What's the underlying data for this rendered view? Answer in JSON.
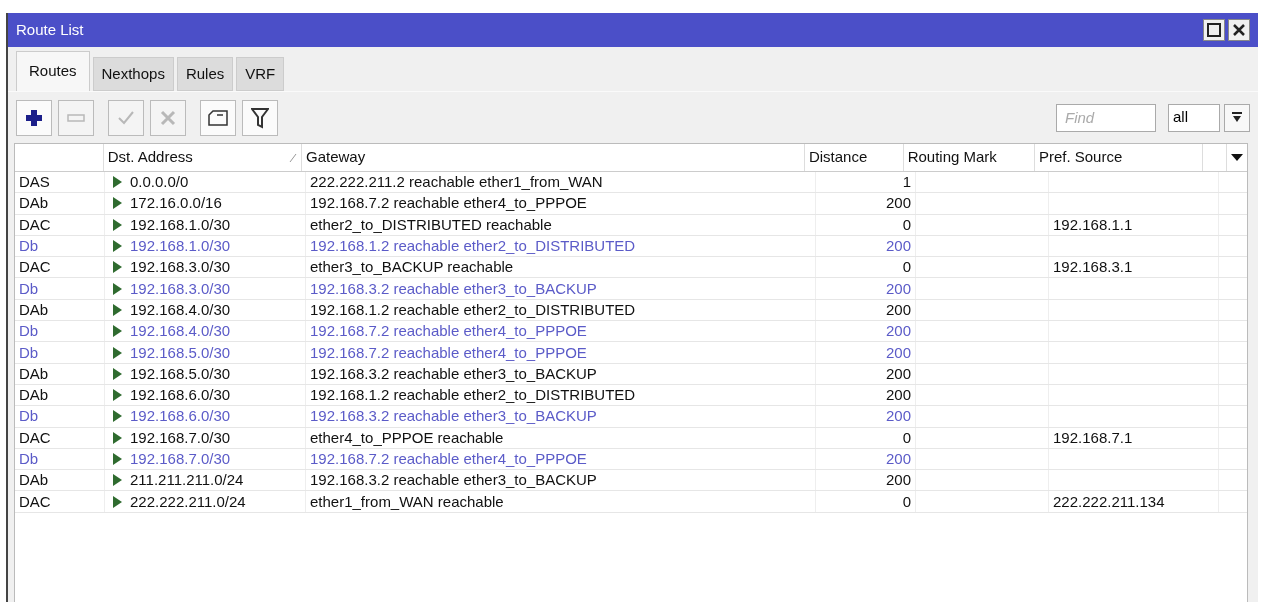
{
  "window": {
    "title": "Route List"
  },
  "tabs": [
    {
      "label": "Routes",
      "selected": true
    },
    {
      "label": "Nexthops",
      "selected": false
    },
    {
      "label": "Rules",
      "selected": false
    },
    {
      "label": "VRF",
      "selected": false
    }
  ],
  "toolbar": {
    "buttons": [
      {
        "kind": "add",
        "disabled": false
      },
      {
        "kind": "remove",
        "disabled": true
      },
      {
        "kind": "enable",
        "disabled": true
      },
      {
        "kind": "disable",
        "disabled": true
      },
      {
        "kind": "comment",
        "disabled": false
      },
      {
        "kind": "filter",
        "disabled": false
      }
    ],
    "find": {
      "placeholder": "Find"
    },
    "scope": {
      "value": "all"
    }
  },
  "table": {
    "columns": [
      {
        "label": "Dst. Address",
        "sorted": true
      },
      {
        "label": "Gateway",
        "sorted": false
      },
      {
        "label": "Distance",
        "sorted": false
      },
      {
        "label": "Routing Mark",
        "sorted": false
      },
      {
        "label": "Pref. Source",
        "sorted": false
      }
    ],
    "rows": [
      {
        "flags": "DAS",
        "active": true,
        "cells": [
          "0.0.0.0/0",
          "222.222.211.2 reachable ether1_from_WAN",
          "1",
          "",
          ""
        ]
      },
      {
        "flags": "DAb",
        "active": true,
        "cells": [
          "172.16.0.0/16",
          "192.168.7.2 reachable ether4_to_PPPOE",
          "200",
          "",
          ""
        ]
      },
      {
        "flags": "DAC",
        "active": true,
        "cells": [
          "192.168.1.0/30",
          "ether2_to_DISTRIBUTED reachable",
          "0",
          "",
          "192.168.1.1"
        ]
      },
      {
        "flags": "Db",
        "active": false,
        "cells": [
          "192.168.1.0/30",
          "192.168.1.2 reachable ether2_to_DISTRIBUTED",
          "200",
          "",
          ""
        ]
      },
      {
        "flags": "DAC",
        "active": true,
        "cells": [
          "192.168.3.0/30",
          "ether3_to_BACKUP reachable",
          "0",
          "",
          "192.168.3.1"
        ]
      },
      {
        "flags": "Db",
        "active": false,
        "cells": [
          "192.168.3.0/30",
          "192.168.3.2 reachable ether3_to_BACKUP",
          "200",
          "",
          ""
        ]
      },
      {
        "flags": "DAb",
        "active": true,
        "cells": [
          "192.168.4.0/30",
          "192.168.1.2 reachable ether2_to_DISTRIBUTED",
          "200",
          "",
          ""
        ]
      },
      {
        "flags": "Db",
        "active": false,
        "cells": [
          "192.168.4.0/30",
          "192.168.7.2 reachable ether4_to_PPPOE",
          "200",
          "",
          ""
        ]
      },
      {
        "flags": "Db",
        "active": false,
        "cells": [
          "192.168.5.0/30",
          "192.168.7.2 reachable ether4_to_PPPOE",
          "200",
          "",
          ""
        ]
      },
      {
        "flags": "DAb",
        "active": true,
        "cells": [
          "192.168.5.0/30",
          "192.168.3.2 reachable ether3_to_BACKUP",
          "200",
          "",
          ""
        ]
      },
      {
        "flags": "DAb",
        "active": true,
        "cells": [
          "192.168.6.0/30",
          "192.168.1.2 reachable ether2_to_DISTRIBUTED",
          "200",
          "",
          ""
        ]
      },
      {
        "flags": "Db",
        "active": false,
        "cells": [
          "192.168.6.0/30",
          "192.168.3.2 reachable ether3_to_BACKUP",
          "200",
          "",
          ""
        ]
      },
      {
        "flags": "DAC",
        "active": true,
        "cells": [
          "192.168.7.0/30",
          "ether4_to_PPPOE reachable",
          "0",
          "",
          "192.168.7.1"
        ]
      },
      {
        "flags": "Db",
        "active": false,
        "cells": [
          "192.168.7.0/30",
          "192.168.7.2 reachable ether4_to_PPPOE",
          "200",
          "",
          ""
        ]
      },
      {
        "flags": "DAb",
        "active": true,
        "cells": [
          "211.211.211.0/24",
          "192.168.3.2 reachable ether3_to_BACKUP",
          "200",
          "",
          ""
        ]
      },
      {
        "flags": "DAC",
        "active": true,
        "cells": [
          "222.222.211.0/24",
          "ether1_from_WAN reachable",
          "0",
          "",
          "222.222.211.134"
        ]
      }
    ]
  }
}
